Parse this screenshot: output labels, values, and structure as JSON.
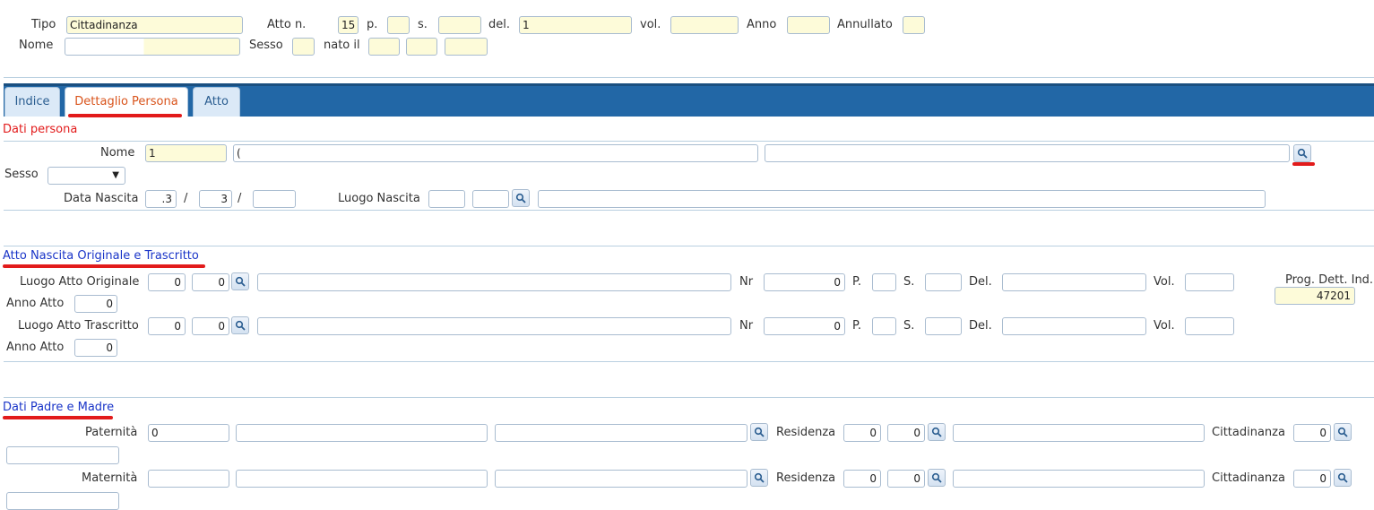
{
  "header": {
    "tipo_label": "Tipo",
    "tipo_value": "Cittadinanza",
    "atto_n_label": "Atto n.",
    "atto_n_value": "15",
    "p_label": "p.",
    "s_label": "s.",
    "del_label": "del.",
    "del_value": "1",
    "vol_label": "vol.",
    "anno_label": "Anno",
    "annullato_label": "Annullato",
    "nome_label": "Nome",
    "sesso_label": "Sesso",
    "nato_il_label": "nato il"
  },
  "tabs": [
    {
      "label": "Indice",
      "active": false
    },
    {
      "label": "Dettaglio Persona",
      "active": true
    },
    {
      "label": "Atto",
      "active": false
    }
  ],
  "dati_persona": {
    "title": "Dati persona",
    "nome_label": "Nome",
    "nome_value1": "1",
    "nome_value2": "(",
    "nome_value3": "",
    "sesso_label": "Sesso",
    "data_nascita_label": "Data Nascita",
    "dn_day": ".3",
    "dn_month": "3",
    "dn_year": "",
    "date_sep": "/",
    "luogo_nascita_label": "Luogo Nascita"
  },
  "atto_nascita": {
    "title": "Atto Nascita Originale e Trascritto",
    "luogo_originale_label": "Luogo Atto Originale",
    "luogo_trascritto_label": "Luogo Atto Trascritto",
    "nr_label": "Nr",
    "p_label": "P.",
    "s_label": "S.",
    "del_label": "Del.",
    "vol_label": "Vol.",
    "anno_atto_label": "Anno Atto",
    "zero": "0",
    "prog_label": "Prog. Dett. Ind.",
    "prog_value": "47201"
  },
  "genitori": {
    "title": "Dati Padre e Madre",
    "paternita_label": "Paternità",
    "paternita_value": "0",
    "maternita_label": "Maternità",
    "residenza_label": "Residenza",
    "cittadinanza_label": "Cittadinanza",
    "zero": "0"
  },
  "colors": {
    "active_tab": "#d9541c",
    "section_title_blue": "#1a35c8",
    "section_title_red": "#e21b1b",
    "tab_bar": "#2267a6",
    "highlight": "#fdfbd9"
  }
}
